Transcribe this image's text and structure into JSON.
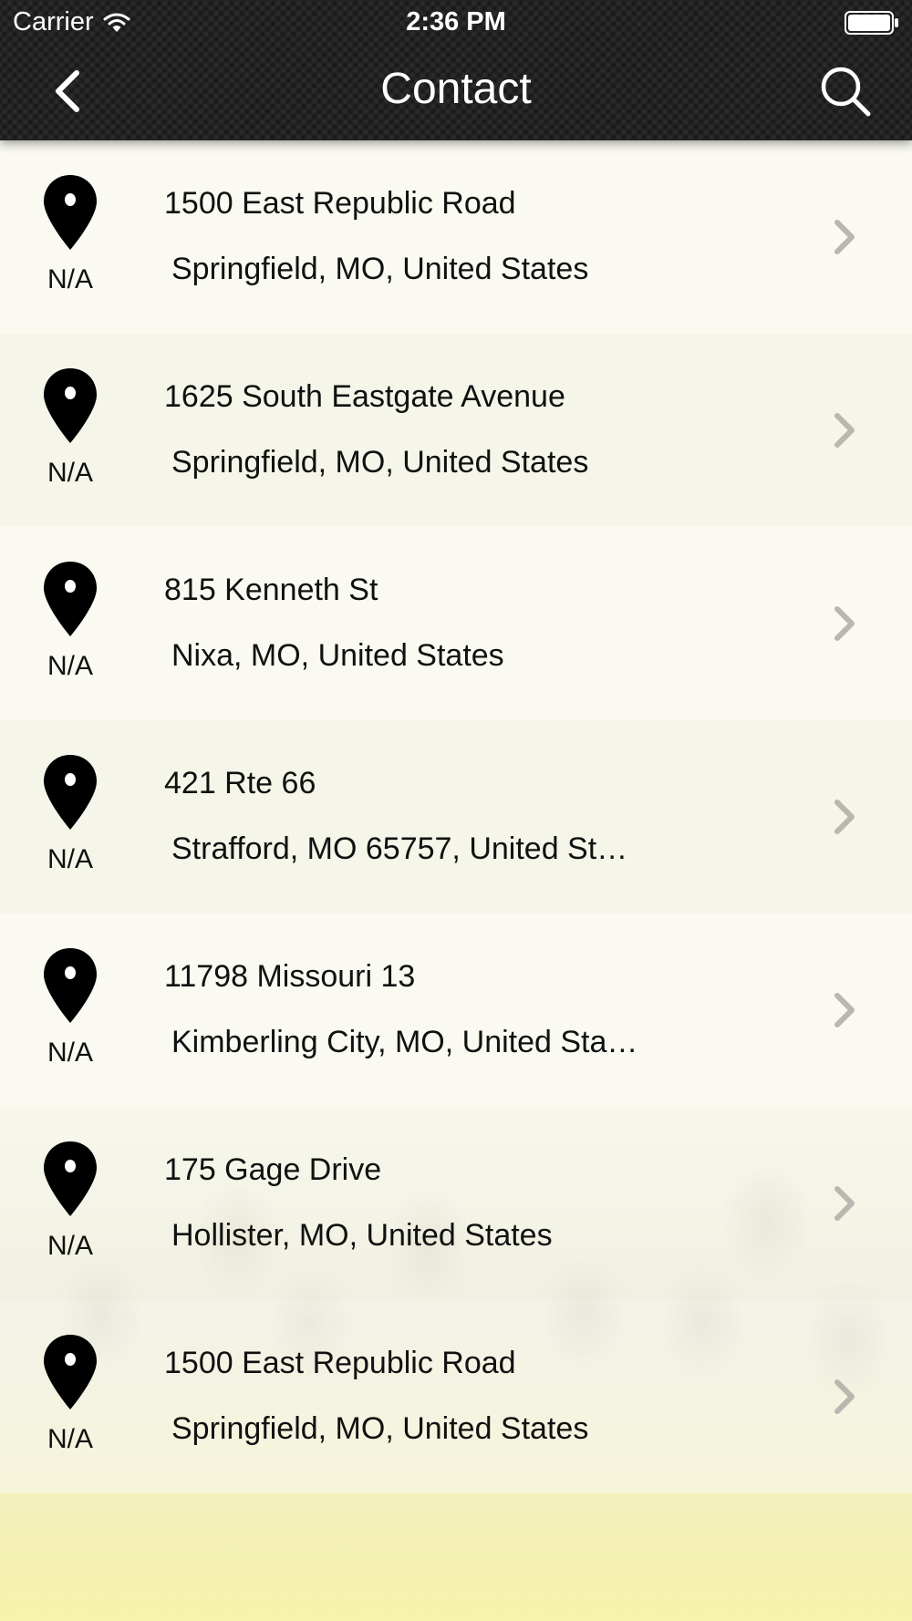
{
  "status_bar": {
    "carrier": "Carrier",
    "time": "2:36 PM"
  },
  "nav": {
    "title": "Contact"
  },
  "icons": {
    "back": "chevron-left-icon",
    "search": "search-icon",
    "pin": "map-pin-icon",
    "disclosure": "chevron-right-icon",
    "wifi": "wifi-icon",
    "battery": "battery-icon"
  },
  "colors": {
    "nav_bar": "#232323",
    "text": "#111111",
    "chevron": "#b8b8b0"
  },
  "locations": [
    {
      "street": "1500 East Republic Road",
      "city": "Springfield, MO, United States",
      "distance": "N/A"
    },
    {
      "street": "1625 South Eastgate Avenue",
      "city": "Springfield, MO, United States",
      "distance": "N/A"
    },
    {
      "street": "815 Kenneth St",
      "city": "Nixa, MO, United States",
      "distance": "N/A"
    },
    {
      "street": "421 Rte 66",
      "city": "Strafford, MO 65757, United St…",
      "distance": "N/A"
    },
    {
      "street": "11798 Missouri 13",
      "city": "Kimberling City, MO, United Sta…",
      "distance": "N/A"
    },
    {
      "street": "175 Gage Drive",
      "city": "Hollister, MO, United States",
      "distance": "N/A"
    },
    {
      "street": "1500 East Republic Road",
      "city": "Springfield, MO, United States",
      "distance": "N/A"
    }
  ]
}
